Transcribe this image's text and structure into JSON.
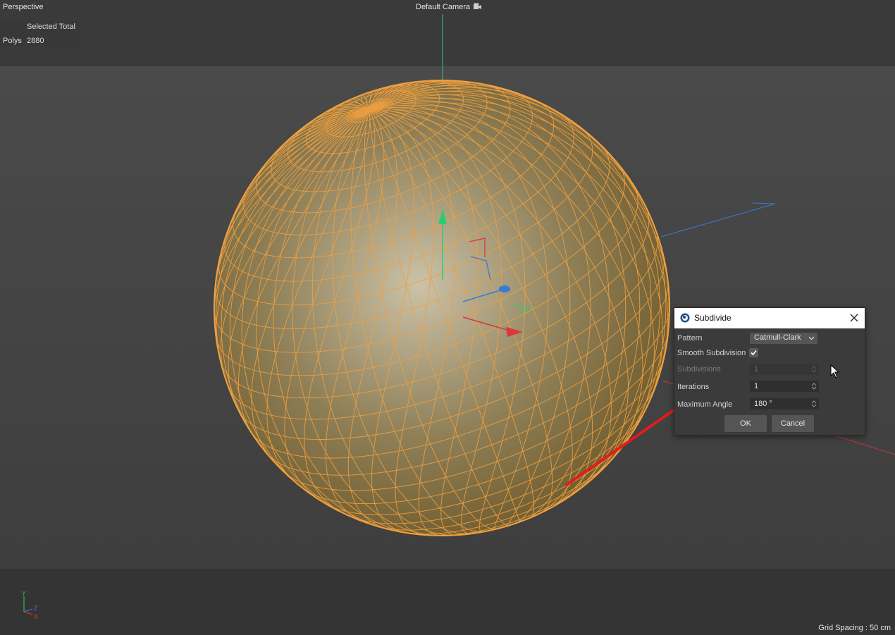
{
  "viewport": {
    "view_name": "Perspective",
    "camera_label": "Default Camera",
    "grid_spacing": "Grid Spacing : 50 cm",
    "axis_labels": {
      "y": "Y",
      "z": "Z",
      "x": "X"
    },
    "icons": {
      "camera": "camera-icon",
      "cursor": "mouse-cursor-icon",
      "axis": "axis-gizmo-icon"
    }
  },
  "stats": {
    "header": "Selected Total",
    "row_label": "Polys",
    "row_value": "2880"
  },
  "dialog": {
    "title": "Subdivide",
    "app_icon": "cinema4d-logo-icon",
    "close_icon": "close-icon",
    "pattern_label": "Pattern",
    "pattern_value": "Catmull-Clark",
    "smooth_label": "Smooth Subdivision",
    "smooth_checked": true,
    "subdivisions_label": "Subdivisions",
    "subdivisions_value": "1",
    "iterations_label": "Iterations",
    "iterations_value": "1",
    "max_angle_label": "Maximum Angle",
    "max_angle_value": "180 °",
    "ok_label": "OK",
    "cancel_label": "Cancel"
  },
  "colors": {
    "wire": "#f0a040",
    "annotation_arrow": "#e01c1c",
    "axis_x": "#d83a3a",
    "axis_y": "#2ecc71",
    "axis_z": "#3a7bd5"
  }
}
